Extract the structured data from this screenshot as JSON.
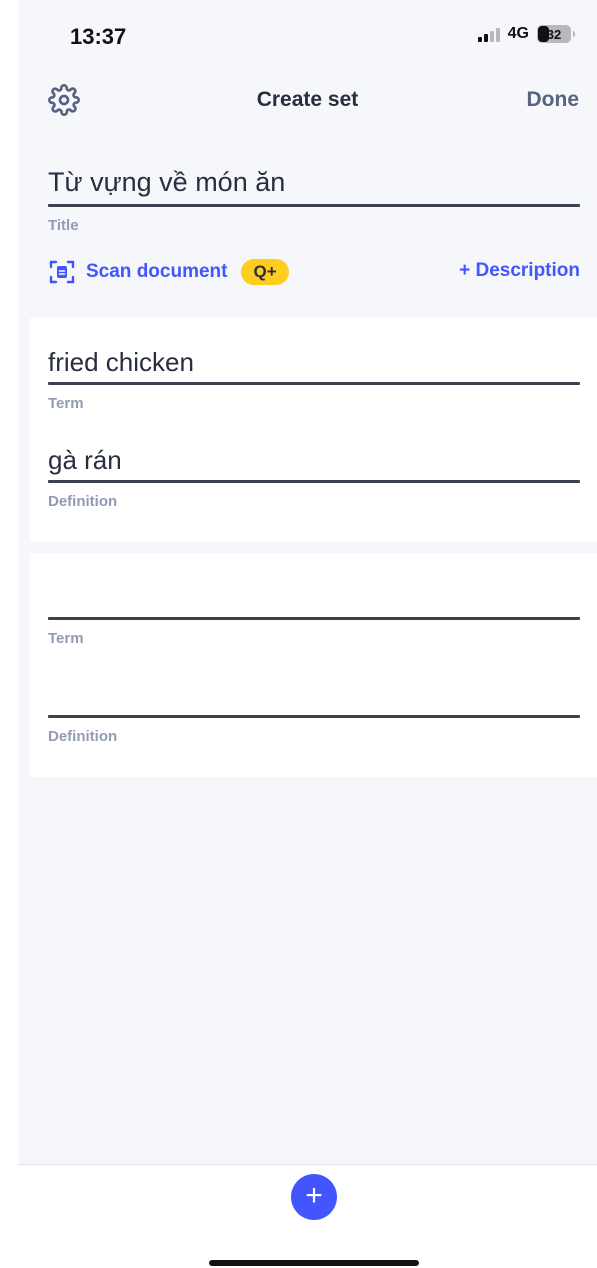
{
  "status_bar": {
    "time": "13:37",
    "network": "4G",
    "battery_level": "32",
    "battery_percent": 32
  },
  "nav": {
    "settings_icon": "gear-icon",
    "title": "Create set",
    "done_label": "Done"
  },
  "set_title": {
    "value": "Từ vựng về món ăn",
    "caption": "Title"
  },
  "actions": {
    "scan_icon": "scan-document-icon",
    "scan_label": "Scan document",
    "badge": "Q+",
    "description_label": "+ Description"
  },
  "cards": [
    {
      "term": "fried chicken",
      "term_caption": "Term",
      "definition": "gà rán",
      "definition_caption": "Definition"
    },
    {
      "term": "",
      "term_caption": "Term",
      "definition": "",
      "definition_caption": "Definition"
    }
  ],
  "bottom": {
    "add_label": "+"
  },
  "colors": {
    "accent": "#4255ff",
    "badge": "#ffcd1f",
    "text_primary": "#282e3e",
    "text_caption": "#939bb4",
    "background": "#f6f7fb"
  }
}
